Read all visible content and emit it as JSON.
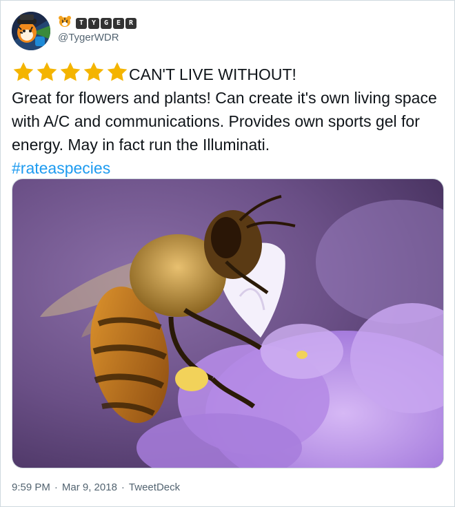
{
  "author": {
    "display_name_letters": [
      "T",
      "Y",
      "G",
      "E",
      "R"
    ],
    "handle": "@TygerWDR",
    "avatar_icon": "tiger-avatar-icon",
    "name_icon": "tiger-face-icon"
  },
  "tweet": {
    "star_count": 5,
    "headline": "CAN'T LIVE WITHOUT!",
    "body": "Great for flowers and plants! Can create it's own living space with A/C and communications. Provides own sports gel for energy. May in fact run the Illuminati.",
    "hashtag": "#rateaspecies"
  },
  "media": {
    "description_icon": "bee-on-flower-photo"
  },
  "meta": {
    "time": "9:59 PM",
    "date": "Mar 9, 2018",
    "source": "TweetDeck",
    "separator": "·"
  },
  "colors": {
    "star": "#f4b400",
    "hashtag": "#1d9bf0",
    "secondary_text": "#536471",
    "border": "#cfd9de"
  }
}
